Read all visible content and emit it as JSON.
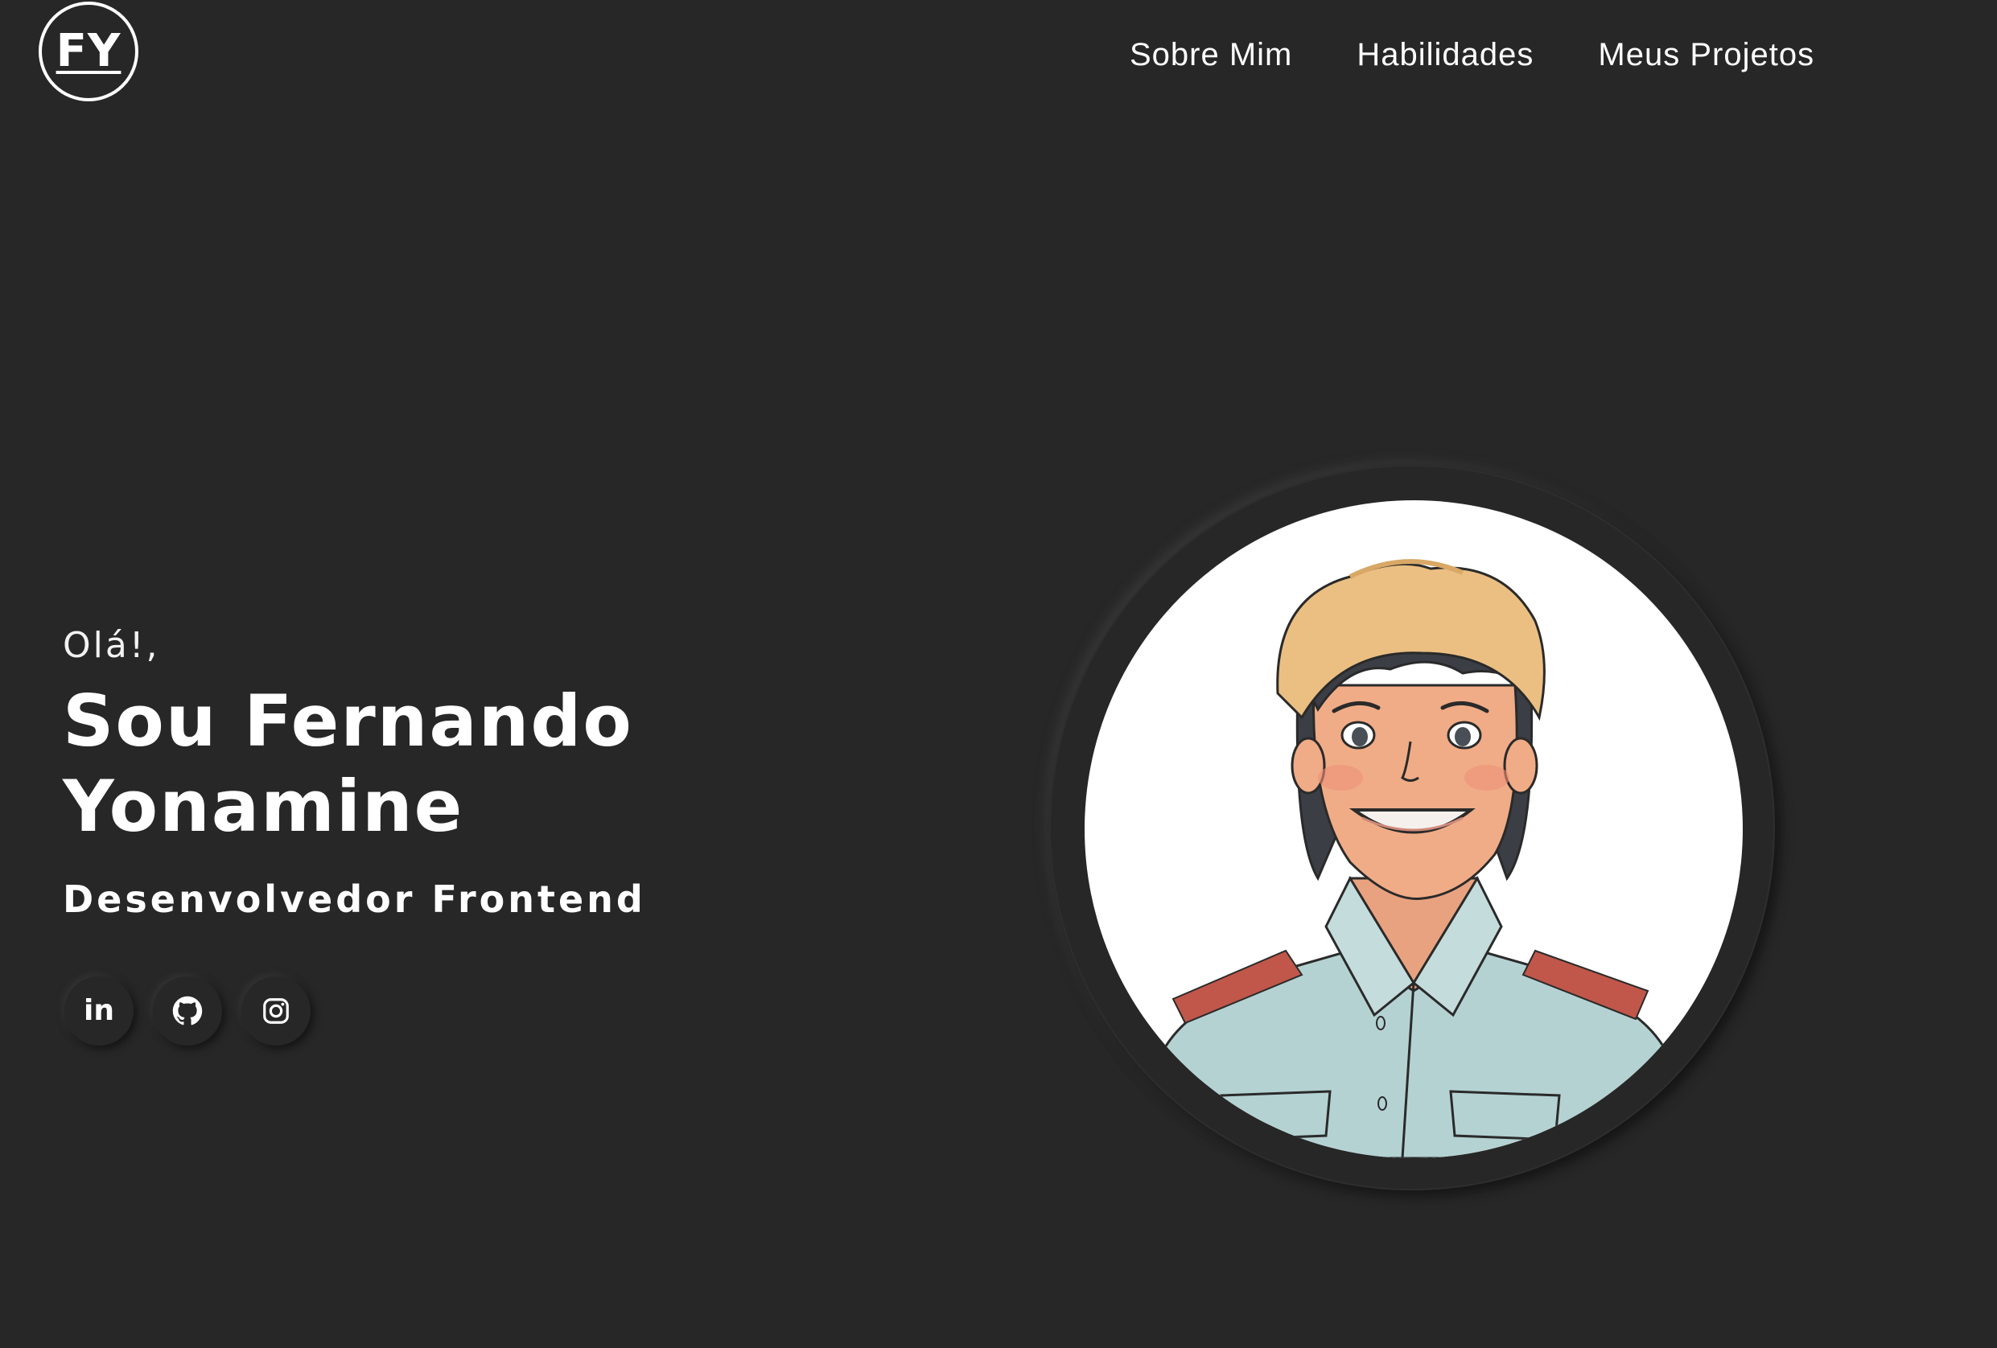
{
  "header": {
    "logo_text": "FY",
    "nav": [
      {
        "label": "Sobre Mim"
      },
      {
        "label": "Habilidades"
      },
      {
        "label": "Meus Projetos"
      }
    ]
  },
  "hero": {
    "greeting": "Olá!,",
    "name": "Sou Fernando Yonamine",
    "role": "Desenvolvedor Frontend"
  },
  "socials": [
    {
      "icon": "linkedin-icon",
      "glyph": "in"
    },
    {
      "icon": "github-icon"
    },
    {
      "icon": "instagram-icon"
    }
  ],
  "colors": {
    "background": "#272727",
    "text": "#ffffff",
    "avatar_bg": "#ffffff",
    "shirt": "#b5d2d3",
    "hat": "#ebbf82",
    "epaulette": "#c0574a"
  }
}
